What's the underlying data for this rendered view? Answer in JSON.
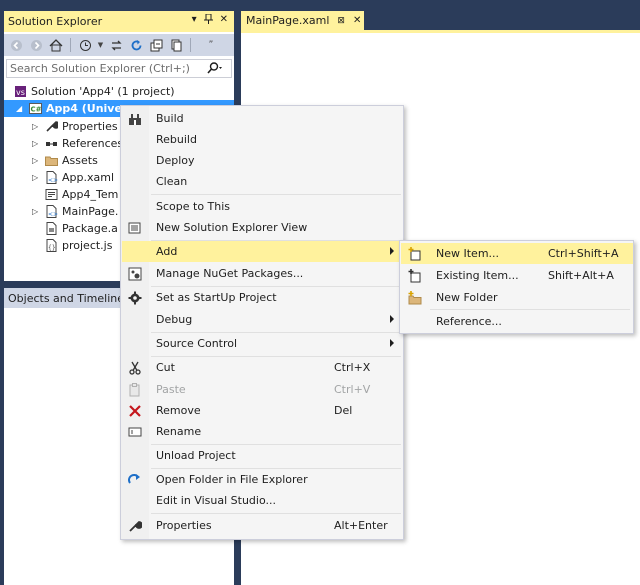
{
  "solution_explorer": {
    "title": "Solution Explorer",
    "title_buttons": [
      "▾",
      "⊟",
      "✕"
    ],
    "search_placeholder": "Search Solution Explorer (Ctrl+;)",
    "tree": [
      {
        "label": "Solution 'App4' (1 project)",
        "icon": "solution-icon"
      },
      {
        "label": "App4 (Unive",
        "icon": "csharp-project-icon",
        "selected": true
      },
      {
        "label": "Properties",
        "icon": "wrench-icon"
      },
      {
        "label": "References",
        "icon": "references-icon"
      },
      {
        "label": "Assets",
        "icon": "folder-icon"
      },
      {
        "label": "App.xaml",
        "icon": "xaml-file-icon"
      },
      {
        "label": "App4_Tem",
        "icon": "certificate-icon"
      },
      {
        "label": "MainPage.",
        "icon": "xaml-file-icon"
      },
      {
        "label": "Package.a",
        "icon": "manifest-icon"
      },
      {
        "label": "project.js",
        "icon": "json-file-icon"
      }
    ]
  },
  "objects_timeline": {
    "title": "Objects and Timeline"
  },
  "editor": {
    "tab_label": "MainPage.xaml",
    "tab_pin": "⊠",
    "tab_close": "✕"
  },
  "context_menu": {
    "items": [
      {
        "label": "Build",
        "icon": "build-icon",
        "shortcut": ""
      },
      {
        "label": "Rebuild",
        "icon": "",
        "shortcut": ""
      },
      {
        "label": "Deploy",
        "icon": "",
        "shortcut": ""
      },
      {
        "label": "Clean",
        "icon": "",
        "shortcut": ""
      },
      {
        "label": "Scope to This",
        "icon": "",
        "shortcut": ""
      },
      {
        "label": "New Solution Explorer View",
        "icon": "new-view-icon",
        "shortcut": ""
      },
      {
        "label": "Add",
        "icon": "",
        "shortcut": "",
        "submenu": true,
        "highlighted": true
      },
      {
        "label": "Manage NuGet Packages...",
        "icon": "nuget-icon",
        "shortcut": ""
      },
      {
        "label": "Set as StartUp Project",
        "icon": "gear-icon",
        "shortcut": ""
      },
      {
        "label": "Debug",
        "icon": "",
        "shortcut": "",
        "submenu": true
      },
      {
        "label": "Source Control",
        "icon": "",
        "shortcut": "",
        "submenu": true
      },
      {
        "label": "Cut",
        "icon": "scissors-icon",
        "shortcut": "Ctrl+X"
      },
      {
        "label": "Paste",
        "icon": "paste-icon",
        "shortcut": "Ctrl+V",
        "disabled": true
      },
      {
        "label": "Remove",
        "icon": "remove-icon",
        "shortcut": "Del"
      },
      {
        "label": "Rename",
        "icon": "rename-icon",
        "shortcut": ""
      },
      {
        "label": "Unload Project",
        "icon": "",
        "shortcut": ""
      },
      {
        "label": "Open Folder in File Explorer",
        "icon": "refresh-arrow-icon",
        "shortcut": ""
      },
      {
        "label": "Edit in Visual Studio...",
        "icon": "",
        "shortcut": ""
      },
      {
        "label": "Properties",
        "icon": "wrench-icon",
        "shortcut": "Alt+Enter"
      }
    ]
  },
  "add_submenu": {
    "items": [
      {
        "label": "New Item...",
        "icon": "new-item-icon",
        "shortcut": "Ctrl+Shift+A",
        "highlighted": true
      },
      {
        "label": "Existing Item...",
        "icon": "existing-item-icon",
        "shortcut": "Shift+Alt+A"
      },
      {
        "label": "New Folder",
        "icon": "new-folder-icon",
        "shortcut": ""
      },
      {
        "label": "Reference...",
        "icon": "",
        "shortcut": ""
      }
    ]
  },
  "colors": {
    "accent_yellow": "#fff29d",
    "chrome_blue": "#2b3c5a",
    "toolbar": "#cfd6e5",
    "selection": "#3399ff"
  }
}
